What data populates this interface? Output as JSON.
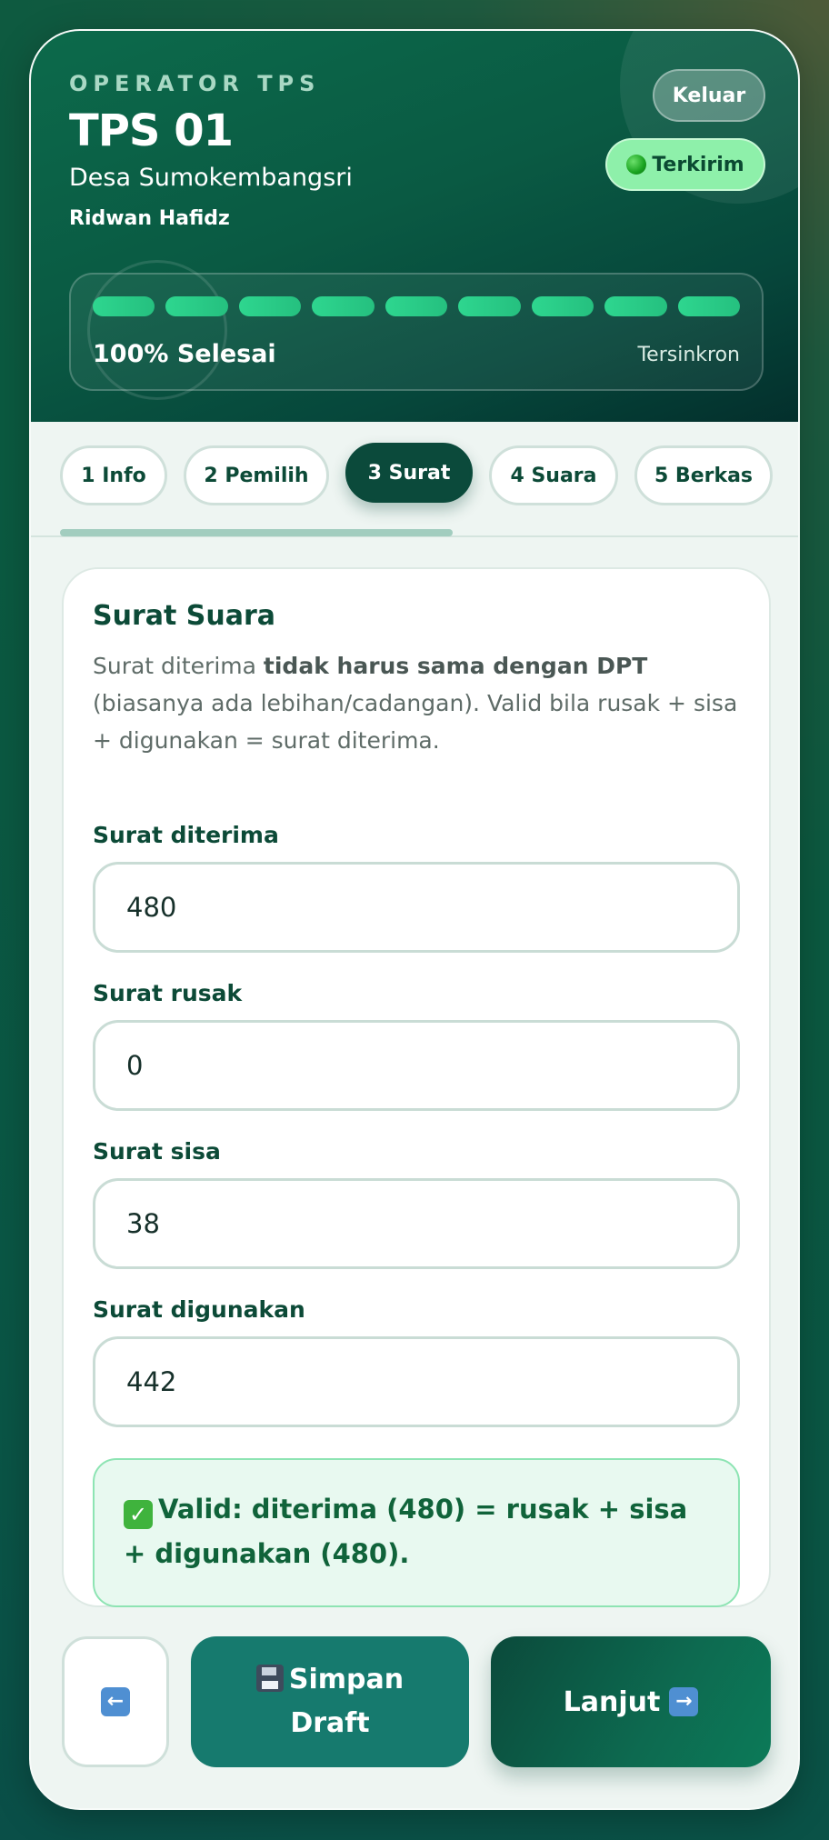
{
  "header": {
    "role": "OPERATOR TPS",
    "tps_name": "TPS 01",
    "village": "Desa Sumokembangsri",
    "operator": "Ridwan Hafidz",
    "logout_label": "Keluar",
    "status_label": "Terkirim",
    "progress": {
      "segments": 9,
      "completed": 9,
      "label": "100% Selesai",
      "sync_label": "Tersinkron"
    }
  },
  "tabs": [
    {
      "label": "1 Info",
      "active": false
    },
    {
      "label": "2 Pemilih",
      "active": false
    },
    {
      "label": "3 Surat",
      "active": true
    },
    {
      "label": "4 Suara",
      "active": false
    },
    {
      "label": "5 Berkas",
      "active": false
    }
  ],
  "form": {
    "title": "Surat Suara",
    "desc_pre": "Surat diterima ",
    "desc_bold": "tidak harus sama dengan DPT",
    "desc_post": " (biasanya ada lebihan/cadangan). Valid bila rusak + sisa + digunakan = surat diterima.",
    "fields": [
      {
        "label": "Surat diterima",
        "value": "480"
      },
      {
        "label": "Surat rusak",
        "value": "0"
      },
      {
        "label": "Surat sisa",
        "value": "38"
      },
      {
        "label": "Surat digunakan",
        "value": "442"
      }
    ],
    "validation": "Valid: diterima (480) = rusak + sisa + digunakan (480)."
  },
  "actions": {
    "back_icon": "left-arrow-icon",
    "save_line1": "Simpan",
    "save_line2": "Draft",
    "next_label": "Lanjut"
  },
  "colors": {
    "primary": "#0b4a3b",
    "accent": "#2ed68f",
    "status_bg": "#8ef0aa",
    "valid_bg": "#e8f9f0"
  }
}
